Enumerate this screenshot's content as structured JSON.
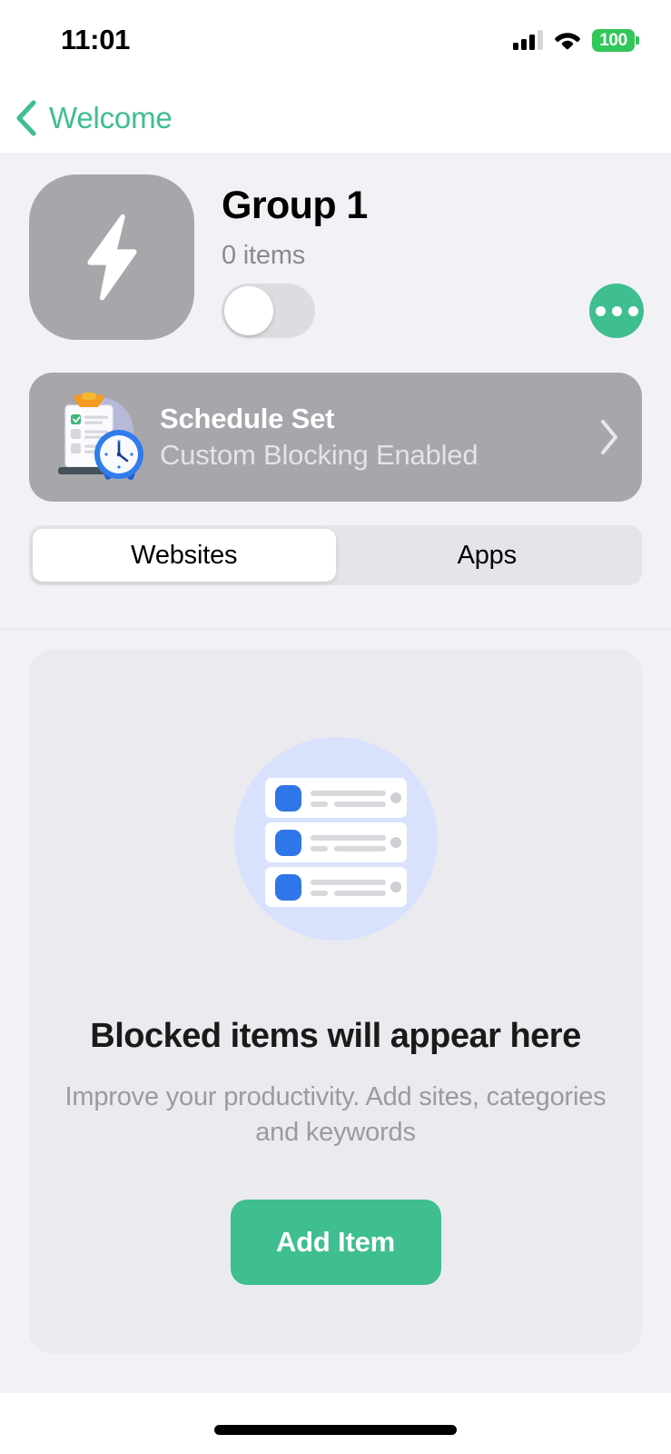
{
  "status_bar": {
    "time": "11:01",
    "battery_percent": "100",
    "signal_icon": "cellular-signal-icon",
    "wifi_icon": "wifi-icon",
    "battery_icon": "battery-icon",
    "battery_color": "#32c759"
  },
  "nav": {
    "back_label": "Welcome",
    "back_icon": "chevron-left-icon",
    "accent_color": "#3fbe8f"
  },
  "group": {
    "avatar_icon": "lightning-bolt-icon",
    "avatar_color": "#a6a6ab",
    "title": "Group 1",
    "item_count": "0 items",
    "toggle_state": "off",
    "more_icon": "ellipsis-icon",
    "more_color": "#3fbe8f"
  },
  "schedule": {
    "icon": "clipboard-clock-icon",
    "title": "Schedule Set",
    "subtitle": "Custom Blocking Enabled",
    "chevron_icon": "chevron-right-icon",
    "card_color": "#a6a6ab"
  },
  "segmented": {
    "selected": "Websites",
    "options": [
      {
        "label": "Websites",
        "active": true
      },
      {
        "label": "Apps",
        "active": false
      }
    ]
  },
  "empty_state": {
    "illustration_icon": "blocked-list-illustration-icon",
    "title": "Blocked items will appear here",
    "subtitle": "Improve your productivity. Add sites, categories and keywords",
    "button_label": "Add Item",
    "button_color": "#3fbe8f"
  },
  "home_indicator": {
    "label": "home-indicator"
  }
}
